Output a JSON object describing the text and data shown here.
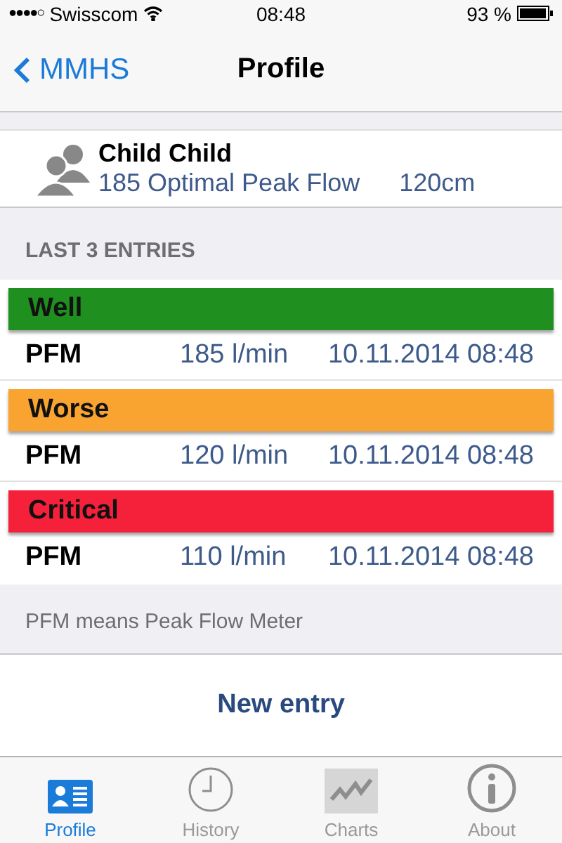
{
  "status_bar": {
    "signal": "●●●●○",
    "carrier": "Swisscom",
    "time": "08:48",
    "battery": "93 %"
  },
  "nav": {
    "back": "MMHS",
    "title": "Profile"
  },
  "profile": {
    "name": "Child Child",
    "peak_flow": "185 Optimal Peak Flow",
    "height": "120cm"
  },
  "section_header": "LAST 3 ENTRIES",
  "entries": [
    {
      "status": "Well",
      "color": "#1f8f1f",
      "label": "PFM",
      "value": "185 l/min",
      "date": "10.11.2014 08:48"
    },
    {
      "status": "Worse",
      "color": "#f9a431",
      "label": "PFM",
      "value": "120 l/min",
      "date": "10.11.2014 08:48"
    },
    {
      "status": "Critical",
      "color": "#f5213a",
      "label": "PFM",
      "value": "110 l/min",
      "date": "10.11.2014 08:48"
    }
  ],
  "footer_note": "PFM means Peak Flow Meter",
  "new_entry_button": "New entry",
  "tabs": [
    {
      "label": "Profile",
      "selected": true
    },
    {
      "label": "History",
      "selected": false
    },
    {
      "label": "Charts",
      "selected": false
    },
    {
      "label": "About",
      "selected": false
    }
  ]
}
